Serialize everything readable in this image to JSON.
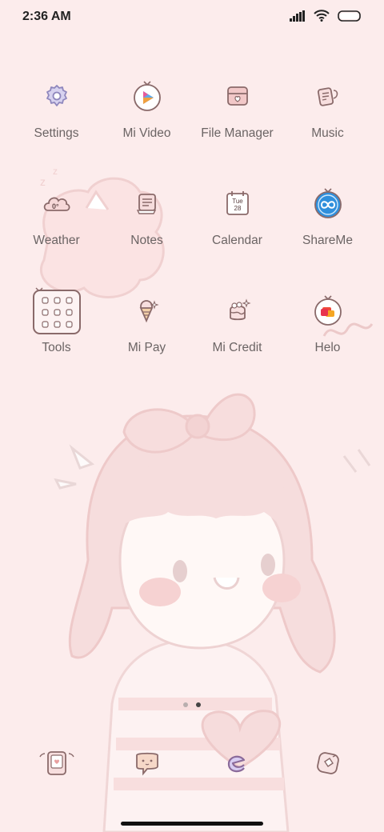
{
  "status_bar": {
    "time": "2:36 AM",
    "icons": [
      "signal-icon",
      "wifi-icon",
      "battery-icon"
    ]
  },
  "apps": [
    {
      "label": "Settings",
      "icon": "gear-icon"
    },
    {
      "label": "Mi Video",
      "icon": "play-icon"
    },
    {
      "label": "File Manager",
      "icon": "folder-icon"
    },
    {
      "label": "Music",
      "icon": "music-icon"
    },
    {
      "label": "Weather",
      "icon": "cloud-icon",
      "icon_text": "0°"
    },
    {
      "label": "Notes",
      "icon": "notepad-icon"
    },
    {
      "label": "Calendar",
      "icon": "calendar-icon",
      "icon_text_day": "Tue",
      "icon_text_date": "28"
    },
    {
      "label": "ShareMe",
      "icon": "infinity-icon"
    },
    {
      "label": "Tools",
      "icon": "folder-grid-icon"
    },
    {
      "label": "Mi Pay",
      "icon": "ice-cream-icon"
    },
    {
      "label": "Mi Credit",
      "icon": "cake-icon"
    },
    {
      "label": "Helo",
      "icon": "chat-bubble-icon"
    }
  ],
  "page_indicator": {
    "total": 2,
    "active": 2
  },
  "dock": [
    {
      "icon": "phone-icon"
    },
    {
      "icon": "message-icon"
    },
    {
      "icon": "browser-icon"
    },
    {
      "icon": "camera-icon"
    }
  ],
  "colors": {
    "background": "#fcecec",
    "icon_stroke": "#8a6a6a",
    "accent_pink": "#f3b8b8",
    "accent_purple": "#9a8ad0"
  }
}
